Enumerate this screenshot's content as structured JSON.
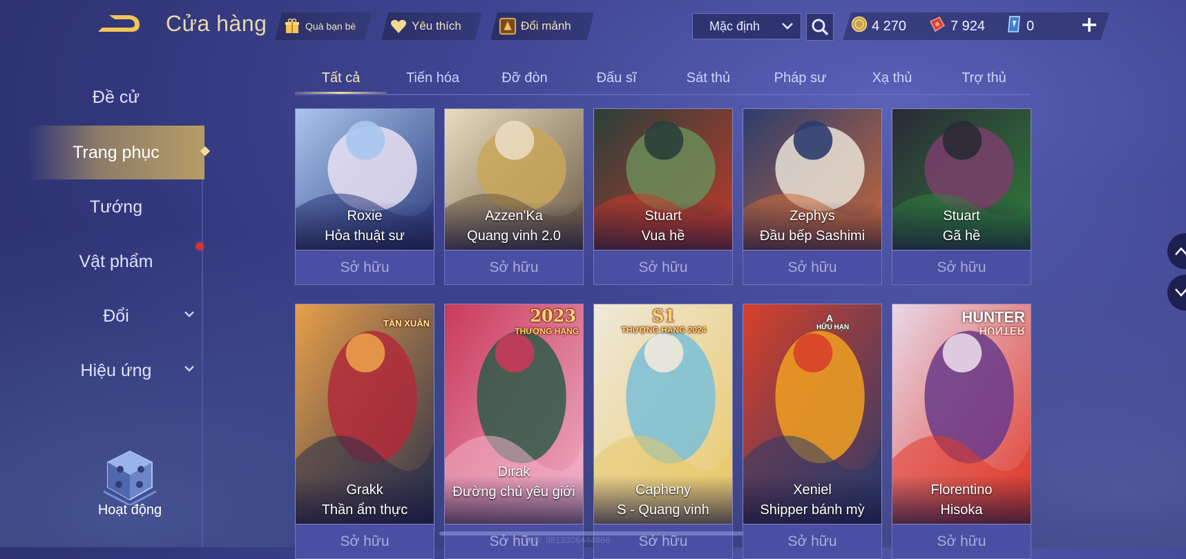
{
  "header": {
    "title": "Cửa hàng",
    "buttons": [
      {
        "label": "Quà bạn bè",
        "icon": "gift-icon"
      },
      {
        "label": "Yêu thích",
        "icon": "heart-icon"
      },
      {
        "label": "Đổi mảnh",
        "icon": "fragment-icon"
      }
    ],
    "sort_select": {
      "value": "Mặc định"
    },
    "currencies": [
      {
        "icon": "gold-coin-icon",
        "value": "4 270"
      },
      {
        "icon": "ruby-voucher-icon",
        "value": "7 924"
      },
      {
        "icon": "blue-voucher-icon",
        "value": "0"
      }
    ]
  },
  "sidebar": {
    "items": [
      {
        "label": "Đề cử",
        "active": false
      },
      {
        "label": "Trang phục",
        "active": true
      },
      {
        "label": "Tướng",
        "active": false
      },
      {
        "label": "Vật phẩm",
        "active": false,
        "notification": true
      },
      {
        "label": "Đổi",
        "active": false,
        "expandable": true
      },
      {
        "label": "Hiệu ứng",
        "active": false,
        "expandable": true
      }
    ],
    "event": {
      "label": "Hoạt động"
    }
  },
  "tabs": [
    {
      "label": "Tất cả",
      "active": true
    },
    {
      "label": "Tiến hóa",
      "active": false
    },
    {
      "label": "Đỡ đòn",
      "active": false
    },
    {
      "label": "Đấu sĩ",
      "active": false
    },
    {
      "label": "Sát thủ",
      "active": false
    },
    {
      "label": "Pháp sư",
      "active": false
    },
    {
      "label": "Xạ thủ",
      "active": false
    },
    {
      "label": "Trợ thủ",
      "active": false
    }
  ],
  "status_label": "Sở hữu",
  "rows": [
    [
      {
        "hero": "Roxie",
        "skin": "Hỏa thuật sư",
        "colors": [
          "#a9c6ee",
          "#e8e0f2",
          "#2c3b7c"
        ]
      },
      {
        "hero": "Azzen'Ka",
        "skin": "Quang vinh 2.0",
        "colors": [
          "#e8dcc0",
          "#c9a75a",
          "#6b5a44"
        ]
      },
      {
        "hero": "Stuart",
        "skin": "Vua hề",
        "colors": [
          "#2a3f3a",
          "#6a8c58",
          "#c43a2a"
        ]
      },
      {
        "hero": "Zephys",
        "skin": "Đầu bếp Sashimi",
        "colors": [
          "#2c3c6e",
          "#e9e2d6",
          "#c96a3a"
        ]
      },
      {
        "hero": "Stuart",
        "skin": "Gã hề",
        "colors": [
          "#2a2a36",
          "#7a3e6a",
          "#2f7d3a"
        ]
      }
    ],
    [
      {
        "hero": "Grakk",
        "skin": "Thần ẩm thực",
        "badge": "TÂN XUÂN",
        "colors": [
          "#e8a04a",
          "#b02a3a",
          "#2a2f4a"
        ]
      },
      {
        "hero": "Dirak",
        "skin": "Đường chủ yêu giới",
        "badge": "2023",
        "badge_sub": "THƯỢNG HẠNG",
        "colors": [
          "#c93a5a",
          "#2f5a4a",
          "#f0b0c8"
        ]
      },
      {
        "hero": "Capheny",
        "skin": "S - Quang vinh",
        "badge": "S1",
        "badge_sub": "THƯỢNG HẠNG 2024",
        "colors": [
          "#f0e9da",
          "#7ac0d8",
          "#e8c86a"
        ]
      },
      {
        "hero": "Xeniel",
        "skin": "Shipper bánh mỳ",
        "badge": "A",
        "badge_sub": "HỮU HẠN",
        "colors": [
          "#d8402a",
          "#f0a020",
          "#2a3a6a"
        ]
      },
      {
        "hero": "Florentino",
        "skin": "Hisoka",
        "badge": "HUNTER",
        "badge_sub": "HUNTER",
        "colors": [
          "#e8d8e8",
          "#6a3a8a",
          "#e03a2a"
        ]
      }
    ]
  ],
  "uid_text": "UID: 9813306444866"
}
